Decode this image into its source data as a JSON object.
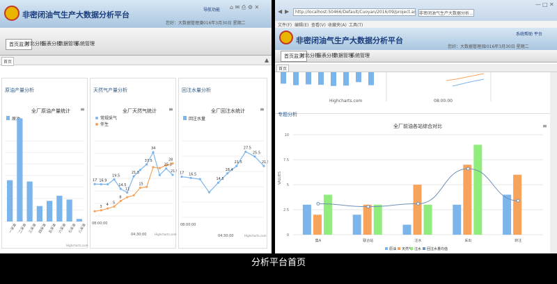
{
  "caption": "分析平台首页",
  "app_title": "非密闭油气生产大数据分析平台",
  "left_window": {
    "header": {
      "links": "导航功能",
      "user": "您好：大数据管理员",
      "date": "2016年3月30日 星期二"
    },
    "nav": [
      "首页监测",
      "对比分析",
      "报表分析",
      "数据管理",
      "系统管理"
    ],
    "tab": "首页",
    "panels": [
      {
        "title": "原油产量分析",
        "chart_title": "全厂原油产量统计"
      },
      {
        "title": "天然气产量分析",
        "chart_title": "全厂天然气统计"
      },
      {
        "title": "回注水量分析",
        "chart_title": "全厂回注水统计"
      }
    ]
  },
  "right_window": {
    "address": "http://localhost:50466/Default/Cuoyan/2016/09/project.aspx?id=0",
    "tab_label": "非密闭油气生产大数据分析...",
    "menu": [
      "文件(F)",
      "编辑(E)",
      "查看(V)",
      "收藏夹(A)",
      "工具(T)"
    ],
    "header_link": "系统帮助 平台",
    "user": "您好：大数据管理员",
    "date": "2016年3月30日 星期二",
    "nav": [
      "首页监测",
      "对比分析",
      "报表分析",
      "数据管理",
      "系统管理"
    ],
    "tab": "首页",
    "section": "专题分析",
    "top_chart_credit": "Highcharts.com",
    "top_chart_time": "08:00:00"
  },
  "chart_data": [
    {
      "type": "bar",
      "title": "全厂原油产量统计",
      "categories": [
        "一采油",
        "二采油",
        "三采油",
        "四采油",
        "五采油",
        "六采油",
        "七采油",
        "八采油"
      ],
      "series": [
        {
          "name": "原油",
          "values": [
            16,
            40,
            15.5,
            6,
            8,
            10,
            8.5,
            1
          ]
        }
      ],
      "ylim": [
        0,
        42
      ],
      "legend": "top-left",
      "credit": "Highcharts.com"
    },
    {
      "type": "line",
      "title": "全厂天然气统计",
      "x": [
        "08:00:00",
        "",
        "",
        "",
        "",
        "",
        "",
        "",
        "",
        "",
        "04:30:00",
        "",
        ""
      ],
      "series": [
        {
          "name": "常规采气",
          "values": [
            17,
            16.9,
            16.9,
            19.5,
            14.5,
            12.5,
            21.1,
            24.5,
            27.5,
            34,
            21.8,
            25.3,
            21.9
          ]
        },
        {
          "name": "伴生",
          "values": [
            2.5,
            3,
            4,
            5,
            8,
            10,
            11,
            15,
            15.5,
            26,
            25.5,
            27,
            28
          ]
        }
      ],
      "data_labels": [
        "17",
        "16.9",
        "19.5",
        "14.5",
        "11",
        "21.5",
        "37.5",
        "34",
        "25.3",
        "21.9",
        "28",
        "3",
        "4",
        "5",
        "8",
        "15"
      ],
      "ylim": [
        0,
        40
      ],
      "legend": "top-left",
      "credit": "Highcharts.com"
    },
    {
      "type": "line",
      "title": "全厂回注水统计",
      "x": [
        "08:00:00",
        "",
        "",
        "",
        "",
        "04:30:00",
        "",
        "",
        ""
      ],
      "series": [
        {
          "name": "回注水量",
          "values": [
            17,
            16.5,
            16,
            10.5,
            14.5,
            18.4,
            21.5,
            27.5,
            25.5,
            21.5
          ]
        }
      ],
      "data_labels": [
        "17",
        "16.5",
        "14.5",
        "18.4",
        "21.5",
        "27.5",
        "25.5",
        "21.5"
      ],
      "ylim": [
        0,
        32
      ],
      "legend": "top-left",
      "credit": "Highcharts.com"
    },
    {
      "type": "bar",
      "title": "全厂前油各站综合对比",
      "categories": [
        "集A",
        "联合站",
        "注水",
        "采出",
        "转注"
      ],
      "series": [
        {
          "name": "原油",
          "values": [
            3,
            2,
            1,
            3,
            4
          ]
        },
        {
          "name": "天然气",
          "values": [
            2,
            3,
            5,
            7,
            6
          ]
        },
        {
          "name": "注水",
          "values": [
            4,
            3,
            3,
            9,
            0
          ]
        },
        {
          "name": "回注水量均值",
          "values": [
            3.1,
            2.8,
            3.1,
            6.6,
            3.4
          ]
        }
      ],
      "ylabel": "VALUES",
      "yticks": [
        "0",
        "2.5",
        "5",
        "7.5",
        "10"
      ],
      "ylim": [
        0,
        10
      ],
      "legend": "bottom"
    }
  ]
}
